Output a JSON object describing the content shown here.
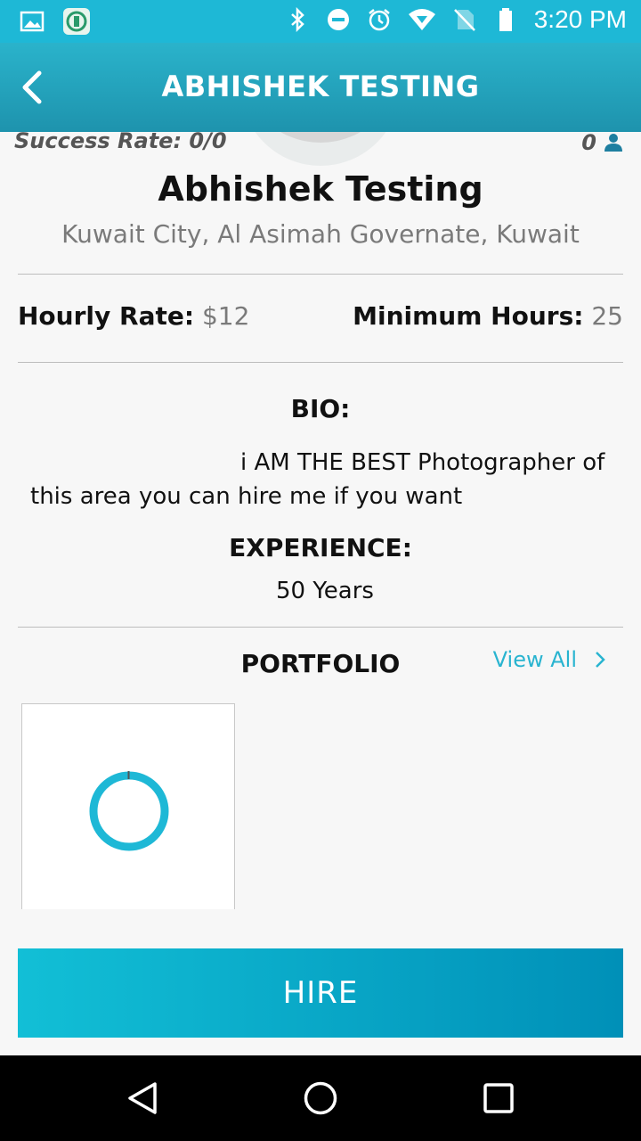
{
  "status_bar": {
    "time": "3:20 PM",
    "icons": [
      "image-icon",
      "app-icon",
      "bluetooth-icon",
      "do-not-disturb-icon",
      "alarm-icon",
      "wifi-icon",
      "no-sim-icon",
      "battery-icon"
    ]
  },
  "app_bar": {
    "title": "ABHISHEK TESTING",
    "back_icon": "chevron-left-icon"
  },
  "profile": {
    "success_rate": "Success Rate: 0/0",
    "count": "0",
    "name": "Abhishek Testing",
    "location": "Kuwait City, Al Asimah Governate, Kuwait"
  },
  "rates": {
    "hourly_label": "Hourly Rate:",
    "hourly_value": "$12",
    "minimum_label": "Minimum Hours:",
    "minimum_value": "25"
  },
  "bio": {
    "heading": "BIO:",
    "text": "i AM THE BEST Photographer of this area you can hire me if you want"
  },
  "experience": {
    "heading": "EXPERIENCE:",
    "value": "50 Years"
  },
  "portfolio": {
    "heading": "PORTFOLIO",
    "view_all": "View All"
  },
  "hire_button": "HIRE",
  "colors": {
    "primary": "#1eb8d6",
    "accent_link": "#29b4d0"
  }
}
